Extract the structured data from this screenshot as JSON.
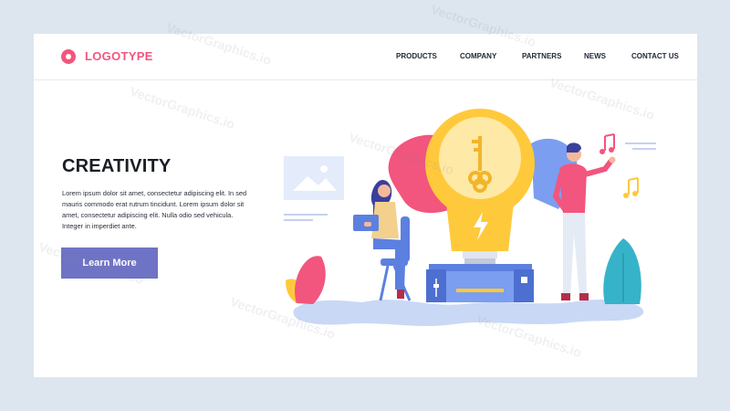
{
  "brand": {
    "logo_text": "LOGOTYPE"
  },
  "nav": {
    "items": [
      {
        "label": "PRODUCTS"
      },
      {
        "label": "COMPANY"
      },
      {
        "label": "PARTNERS"
      },
      {
        "label": "NEWS"
      },
      {
        "label": "CONTACT US"
      }
    ]
  },
  "hero": {
    "title": "CREATIVITY",
    "body": "Lorem ipsum dolor sit amet, consectetur adipiscing elit. In sed mauris commodo erat rutrum tincidunt. Lorem ipsum dolor sit amet, consectetur adipiscing elit. Nulla  odio sed vehicula. Integer in imperdiet ante.",
    "cta_label": "Learn More"
  },
  "colors": {
    "background": "#dde6ef",
    "accent_pink": "#f2557d",
    "button": "#6f73c5",
    "bulb": "#ffc93c",
    "blob_blue": "#7b9ef0"
  },
  "watermark": {
    "text": "VectorGraphics.io"
  },
  "illustration": {
    "icons": [
      "lightbulb-icon",
      "key-icon",
      "lightning-icon",
      "music-note-icon",
      "image-placeholder-icon",
      "plant-icon"
    ]
  }
}
